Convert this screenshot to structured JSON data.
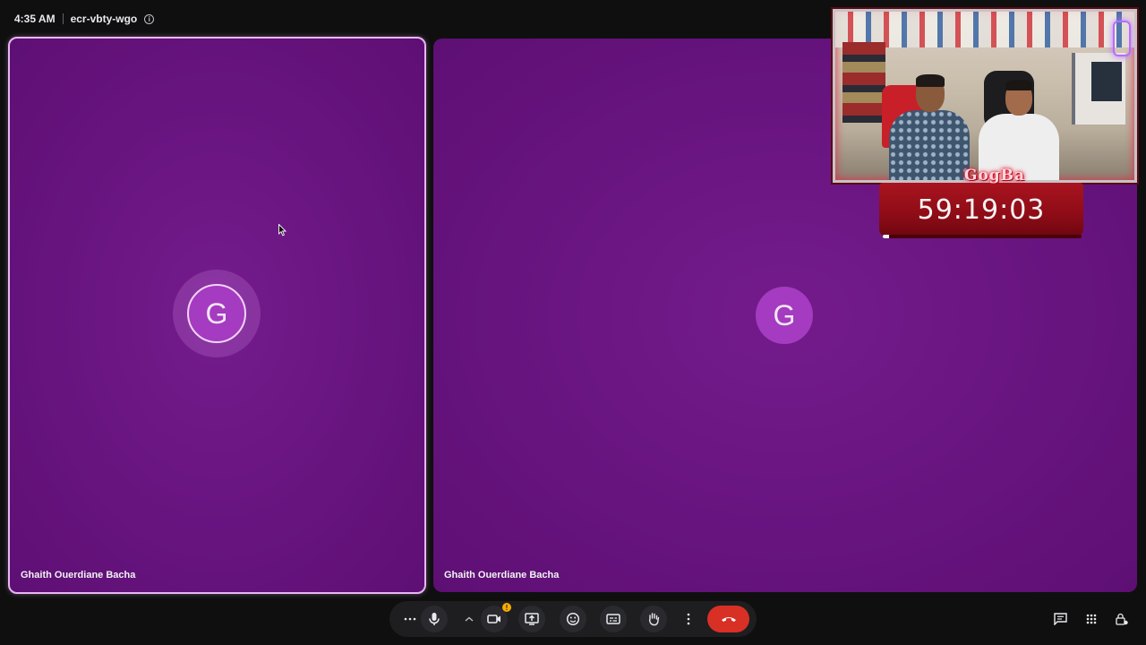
{
  "meeting": {
    "time": "4:35 AM",
    "code": "ecr-vbty-wgo"
  },
  "tiles": [
    {
      "initial": "G",
      "name": "Ghaith Ouerdiane Bacha"
    },
    {
      "initial": "G",
      "name": "Ghaith Ouerdiane Bacha"
    }
  ],
  "stream_overlay": {
    "brand": "GogBa",
    "timer": "59:19:03",
    "timer_progress": 0.03
  },
  "controls": {
    "camera_warning_badge": "!",
    "icons": [
      "more-options-icon",
      "microphone-icon",
      "chevron-up-icon",
      "camera-icon",
      "present-screen-icon",
      "emoji-icon",
      "captions-icon",
      "raise-hand-icon",
      "more-vert-icon",
      "hang-up-icon",
      "chat-icon",
      "activities-icon",
      "host-controls-icon"
    ]
  },
  "colors": {
    "tile_purple": "#6b1683",
    "avatar": "#a53bc0",
    "active_border": "#e9b6f2",
    "hangup": "#d93025",
    "timer_red": "#a8141f"
  }
}
